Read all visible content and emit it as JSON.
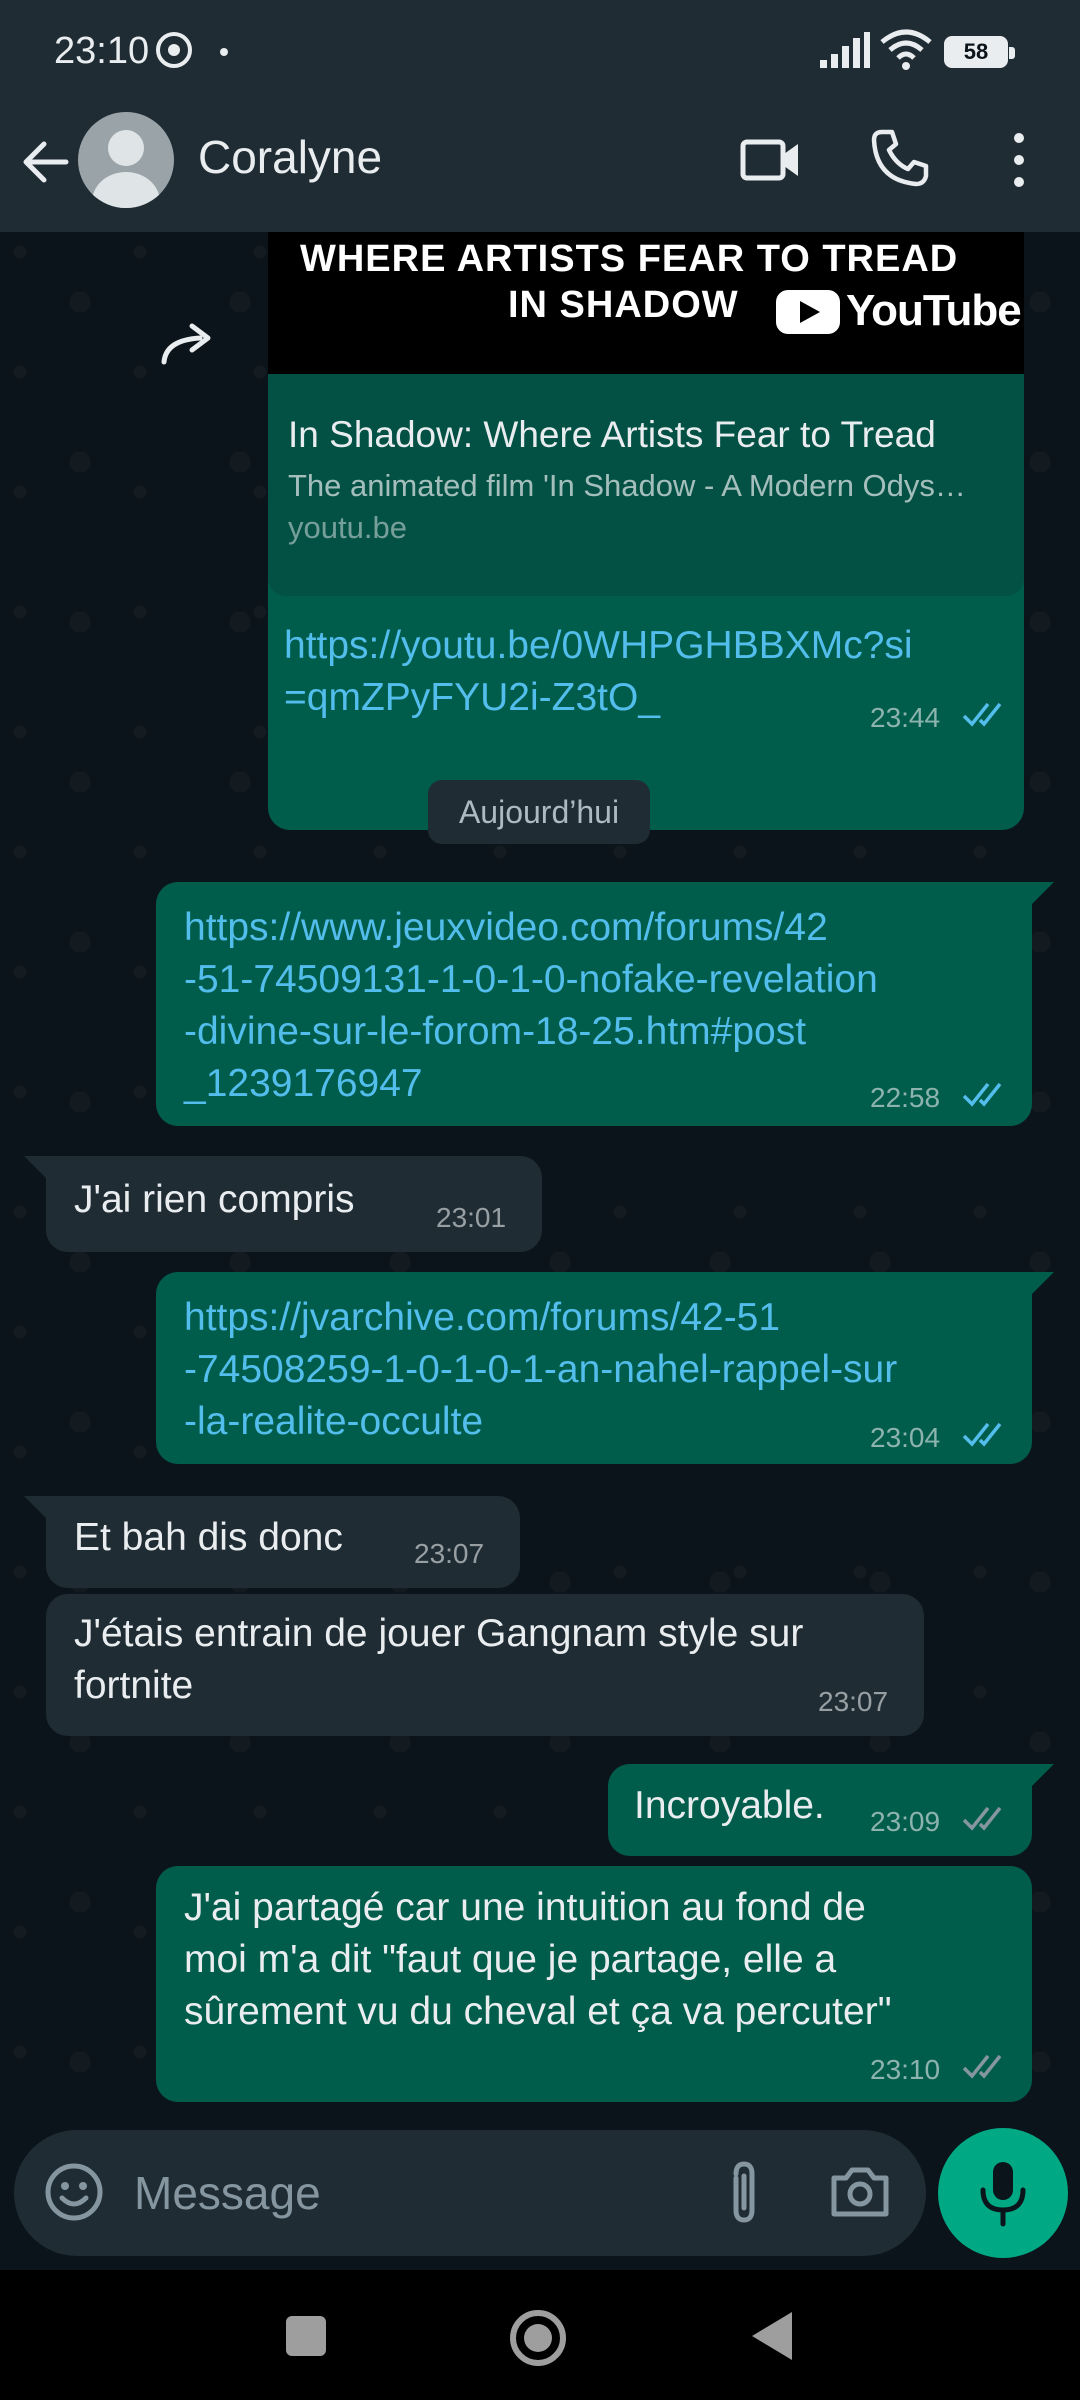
{
  "status_bar": {
    "time": "23:10",
    "battery": "58"
  },
  "header": {
    "contact_name": "Coralyne"
  },
  "preview": {
    "thumb_line1": "WHERE ARTISTS FEAR TO TREAD",
    "thumb_line2": "IN SHADOW",
    "yt_logo": "YouTube",
    "title": "In Shadow: Where Artists Fear to Tread",
    "description": "The animated film 'In Shadow - A Modern Odys…",
    "domain": "youtu.be",
    "url_line1": "https://youtu.be/0WHPGHBBXMc?si",
    "url_line2": "=qmZPyFYU2i-Z3tO_",
    "time": "23:44"
  },
  "date_separator": "Aujourd’hui",
  "messages": [
    {
      "lines": [
        "https://www.jeuxvideo.com/forums/42",
        "-51-74509131-1-0-1-0-nofake-revelation",
        "-divine-sur-le-forom-18-25.htm#post",
        "_1239176947"
      ],
      "time": "22:58"
    },
    {
      "lines": [
        "J'ai rien compris"
      ],
      "time": "23:01"
    },
    {
      "lines": [
        "https://jvarchive.com/forums/42-51",
        "-74508259-1-0-1-0-1-an-nahel-rappel-sur",
        "-la-realite-occulte"
      ],
      "time": "23:04"
    },
    {
      "lines": [
        "Et bah dis donc"
      ],
      "time": "23:07"
    },
    {
      "lines": [
        "J'étais entrain de jouer Gangnam style sur",
        "fortnite"
      ],
      "time": "23:07"
    },
    {
      "lines": [
        "Incroyable."
      ],
      "time": "23:09"
    },
    {
      "lines": [
        "J'ai partagé car une intuition au fond de",
        "moi m'a dit \"faut que je partage, elle a",
        "sûrement vu du cheval et ça va percuter\""
      ],
      "time": "23:10"
    }
  ],
  "input": {
    "placeholder": "Message"
  },
  "colors": {
    "outgoing": "#005c4b",
    "incoming": "#1f2c34",
    "link": "#53bdeb",
    "read_ticks": "#53bdeb",
    "accent": "#00a884"
  }
}
